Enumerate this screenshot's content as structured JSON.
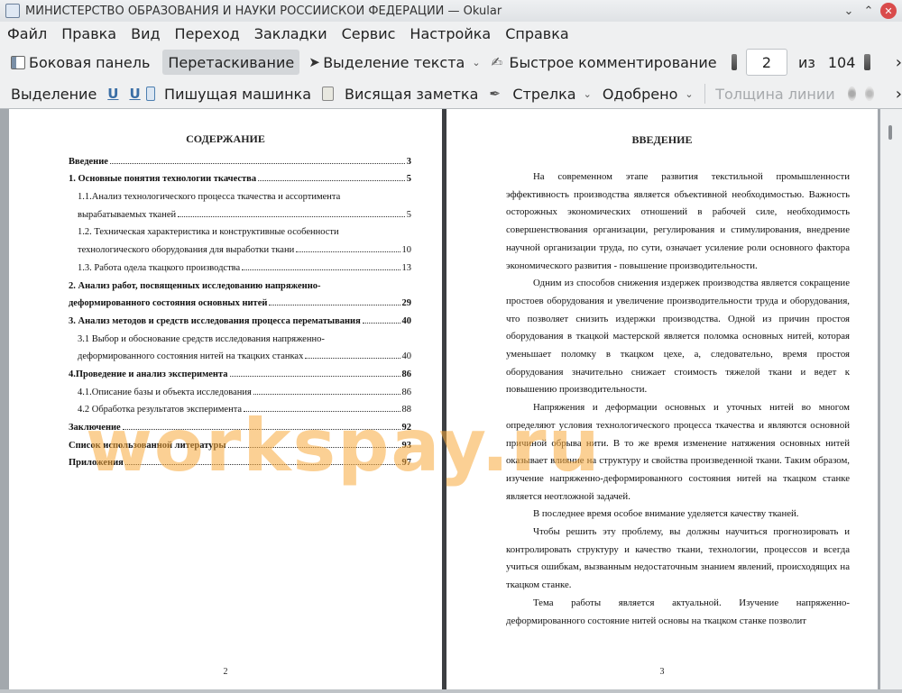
{
  "window": {
    "title": "МИНИСТЕРСТВО ОБРАЗОВАНИЯ И НАУКИ РОССИЙСКОЙ ФЕДЕРАЦИИ  — Okular",
    "minimize": "⌄",
    "maximize": "⌃",
    "close": "✕"
  },
  "menu": [
    "Файл",
    "Правка",
    "Вид",
    "Переход",
    "Закладки",
    "Сервис",
    "Настройка",
    "Справка"
  ],
  "toolbar1": {
    "sidebar": "Боковая панель",
    "drag": "Перетаскивание",
    "text_select": "Выделение текста",
    "quick_comment": "Быстрое комментирование",
    "page_value": "2",
    "of_label": "из",
    "total_pages": "104",
    "more": "›"
  },
  "toolbar2": {
    "selection": "Выделение",
    "typewriter": "Пишущая машинка",
    "sticky_note": "Висящая заметка",
    "arrow": "Стрелка",
    "stamp": "Одобрено",
    "line_width": "Толщина линии",
    "more": "›"
  },
  "page1": {
    "heading": "СОДЕРЖАНИЕ",
    "toc": [
      {
        "text": "Введение",
        "page": "3",
        "bold": true,
        "indent": false
      },
      {
        "text": "1. Основные понятия технологии ткачества",
        "page": "5",
        "bold": true,
        "indent": false
      },
      {
        "text": "1.1.Анализ технологического процесса ткачества и ассортимента",
        "page": "",
        "bold": false,
        "indent": true
      },
      {
        "text": "вырабатываемых тканей",
        "page": "5",
        "bold": false,
        "indent": true
      },
      {
        "text": "1.2. Техническая характеристика и конструктивные особенности",
        "page": "",
        "bold": false,
        "indent": true
      },
      {
        "text": "технологического оборудования для выработки ткани",
        "page": "10",
        "bold": false,
        "indent": true
      },
      {
        "text": "1.3.   Работа одела ткацкого производства",
        "page": "13",
        "bold": false,
        "indent": true
      },
      {
        "text": "2. Анализ работ, посвященных исследованию напряженно-",
        "page": "",
        "bold": true,
        "indent": false
      },
      {
        "text": "деформированного состояния основных нитей",
        "page": "29",
        "bold": true,
        "indent": false
      },
      {
        "text": "3. Анализ методов и средств исследования процесса перематывания",
        "page": "40",
        "bold": true,
        "indent": false
      },
      {
        "text": "3.1 Выбор и обоснование средств исследования напряженно-",
        "page": "",
        "bold": false,
        "indent": true
      },
      {
        "text": "деформированного состояния нитей на ткацких станках",
        "page": "40",
        "bold": false,
        "indent": true
      },
      {
        "text": "4.Проведение и анализ эксперимента",
        "page": "86",
        "bold": true,
        "indent": false
      },
      {
        "text": "4.1.Описание базы и объекта исследования",
        "page": "86",
        "bold": false,
        "indent": true
      },
      {
        "text": "4.2 Обработка результатов эксперимента",
        "page": "88",
        "bold": false,
        "indent": true
      },
      {
        "text": "Заключение",
        "page": "92",
        "bold": true,
        "indent": false
      },
      {
        "text": "Список использованной литературы",
        "page": "93",
        "bold": true,
        "indent": false
      },
      {
        "text": "Приложения",
        "page": "97",
        "bold": true,
        "indent": false
      }
    ],
    "page_number": "2"
  },
  "page2": {
    "heading": "ВВЕДЕНИЕ",
    "paragraphs": [
      "На современном этапе развития текстильной промышленности эффективность производства является объективной необходимостью. Важность осторожных экономических отношений в рабочей силе, необходимость совершенствования организации, регулирования и стимулирования, внедрение научной организации труда, по сути, означает усиление роли основного фактора экономического развития - повышение производительности.",
      "Одним из способов снижения издержек производства является сокращение простоев оборудования и увеличение производительности труда и оборудования, что позволяет снизить издержки производства. Одной из причин простоя оборудования в ткацкой мастерской является поломка основных нитей, которая уменьшает поломку в ткацком цехе, а, следовательно, время простоя оборудования значительно снижает стоимость тяжелой ткани и ведет к повышению производительности.",
      "Напряжения и деформации основных и уточных нитей во многом определяют условия технологического процесса ткачества и являются основной причиной обрыва нити. В то же время изменение натяжения основных нитей оказывает влияние на структуру и свойства произведенной ткани. Таким образом, изучение напряженно-деформированного состояния нитей на ткацком станке является неотложной задачей.",
      "В последнее время особое внимание уделяется качеству тканей.",
      "Чтобы решить эту проблему, вы должны научиться прогнозировать и контролировать структуру и качество ткани, технологии, процессов и всегда учиться ошибкам, вызванным недостаточным знанием явлений, происходящих на ткацком станке.",
      "Тема работы является актуальной. Изучение напряженно-деформированного состояние нитей основы на ткацком станке позволит"
    ],
    "page_number": "3"
  },
  "watermark": "workspay.ru"
}
